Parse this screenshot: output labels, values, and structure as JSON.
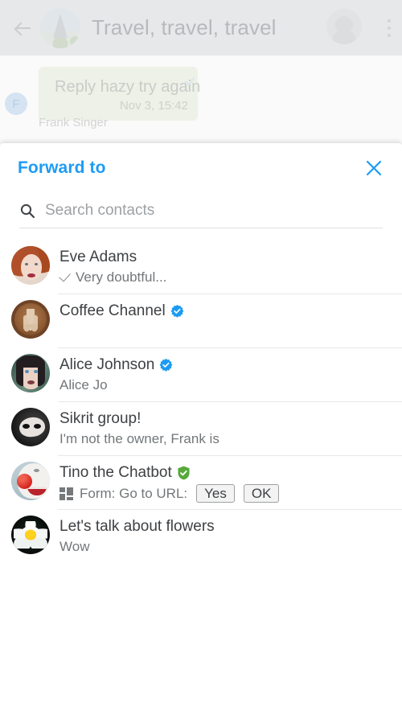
{
  "background_chat": {
    "back_icon": "arrow-left-icon",
    "chat_avatar_icon": "eiffel-tower-avatar",
    "title": "Travel, travel, travel",
    "user_avatar_icon": "user-avatar",
    "overflow_icon": "more-vertical-icon",
    "message": {
      "text": "Reply hazy try again",
      "time": "Nov 3, 15:42",
      "sender_initial": "F",
      "sender_name": "Frank Singer"
    }
  },
  "dialog": {
    "title": "Forward to",
    "title_color": "#1e9bf5",
    "close_icon": "close-icon",
    "search": {
      "icon": "search-icon",
      "placeholder": "Search contacts",
      "value": ""
    },
    "contacts": [
      {
        "name": "Eve Adams",
        "avatar_icon": "avatar-eve-adams",
        "badge": "",
        "subtitle": "Very doubtful...",
        "has_read_tick": true
      },
      {
        "name": "Coffee Channel",
        "avatar_icon": "avatar-coffee-latte",
        "badge": "verified-badge",
        "subtitle": "",
        "has_read_tick": false
      },
      {
        "name": "Alice Johnson",
        "avatar_icon": "avatar-alice-johnson",
        "badge": "verified-badge",
        "subtitle": "Alice Jo",
        "has_read_tick": false
      },
      {
        "name": "Sikrit group!",
        "avatar_icon": "avatar-venetian-mask",
        "badge": "",
        "subtitle": "I'm not the owner, Frank is",
        "has_read_tick": false
      },
      {
        "name": "Tino the Chatbot",
        "avatar_icon": "avatar-clown",
        "badge": "shield-verified-badge",
        "subtitle": "Form: Go to URL:",
        "has_read_tick": false,
        "form": {
          "icon": "form-grid-icon",
          "buttons": [
            "Yes",
            "OK"
          ]
        }
      },
      {
        "name": "Let's talk about flowers",
        "avatar_icon": "avatar-water-lily",
        "badge": "",
        "subtitle": "Wow",
        "has_read_tick": false
      }
    ]
  },
  "colors": {
    "accent": "#1e9bf5",
    "verified_blue": "#1d9bf0",
    "shield_green": "#56a93a",
    "text_primary": "#3e4144",
    "text_secondary": "#73777a"
  }
}
